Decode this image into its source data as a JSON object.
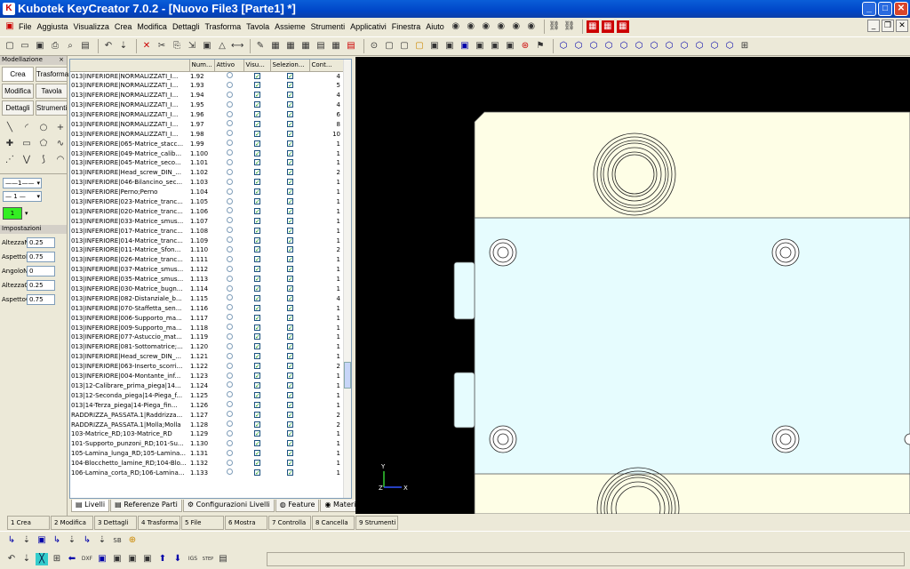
{
  "window": {
    "title": "Kubotek KeyCreator 7.0.2 - [Nuovo File3 [Parte1] *]",
    "min": "_",
    "max": "□",
    "close": "✕"
  },
  "menu": [
    "File",
    "Aggiusta",
    "Visualizza",
    "Crea",
    "Modifica",
    "Dettagli",
    "Trasforma",
    "Tavola",
    "Assieme",
    "Strumenti",
    "Applicativi",
    "Finestra",
    "Aiuto"
  ],
  "left_panel": {
    "title": "Modellazione",
    "close": "×",
    "buttons": [
      "Crea",
      "Trasforma",
      "Modifica",
      "Tavola",
      "Dettagli",
      "Strumenti"
    ],
    "line_type": "——1——",
    "line_width": "— 1 —",
    "color_value": "1",
    "color_hex": "#33ee22",
    "settings_title": "Impostazioni",
    "settings": [
      {
        "label": "AltezzaN",
        "value": "0.25"
      },
      {
        "label": "AspettoN",
        "value": "0.75"
      },
      {
        "label": "AngoloN",
        "value": "0"
      },
      {
        "label": "AltezzaQ",
        "value": "0.25"
      },
      {
        "label": "AspettoQ",
        "value": "0.75"
      }
    ]
  },
  "table": {
    "columns": [
      "",
      "Num...",
      "Attivo",
      "Visu...",
      "Selezion...",
      "Cont..."
    ],
    "rows": [
      [
        "013|INFERIORE|NORMALIZZATI_I...",
        "1.92",
        "4"
      ],
      [
        "013|INFERIORE|NORMALIZZATI_I...",
        "1.93",
        "5"
      ],
      [
        "013|INFERIORE|NORMALIZZATI_I...",
        "1.94",
        "4"
      ],
      [
        "013|INFERIORE|NORMALIZZATI_I...",
        "1.95",
        "4"
      ],
      [
        "013|INFERIORE|NORMALIZZATI_I...",
        "1.96",
        "6"
      ],
      [
        "013|INFERIORE|NORMALIZZATI_I...",
        "1.97",
        "8"
      ],
      [
        "013|INFERIORE|NORMALIZZATI_I...",
        "1.98",
        "10"
      ],
      [
        "013|INFERIORE|065-Matrice_stacc...",
        "1.99",
        "1"
      ],
      [
        "013|INFERIORE|049-Matrice_calib...",
        "1.100",
        "1"
      ],
      [
        "013|INFERIORE|045-Matrice_seco...",
        "1.101",
        "1"
      ],
      [
        "013|INFERIORE|Head_screw_DIN_...",
        "1.102",
        "2"
      ],
      [
        "013|INFERIORE|046-Bilancino_sec...",
        "1.103",
        "1"
      ],
      [
        "013|INFERIORE|Perno;Perno",
        "1.104",
        "1"
      ],
      [
        "013|INFERIORE|023-Matrice_tranc...",
        "1.105",
        "1"
      ],
      [
        "013|INFERIORE|020-Matrice_tranc...",
        "1.106",
        "1"
      ],
      [
        "013|INFERIORE|033-Matrice_smus...",
        "1.107",
        "1"
      ],
      [
        "013|INFERIORE|017-Matrice_tranc...",
        "1.108",
        "1"
      ],
      [
        "013|INFERIORE|014-Matrice_tranc...",
        "1.109",
        "1"
      ],
      [
        "013|INFERIORE|011-Matrice_Sfon...",
        "1.110",
        "2"
      ],
      [
        "013|INFERIORE|026-Matrice_tranc...",
        "1.111",
        "1"
      ],
      [
        "013|INFERIORE|037-Matrice_smus...",
        "1.112",
        "1"
      ],
      [
        "013|INFERIORE|035-Matrice_smus...",
        "1.113",
        "1"
      ],
      [
        "013|INFERIORE|030-Matrice_bugn...",
        "1.114",
        "1"
      ],
      [
        "013|INFERIORE|082-Distanziale_b...",
        "1.115",
        "4"
      ],
      [
        "013|INFERIORE|070-Staffetta_sen...",
        "1.116",
        "1"
      ],
      [
        "013|INFERIORE|006-Supporto_ma...",
        "1.117",
        "1"
      ],
      [
        "013|INFERIORE|009-Supporto_ma...",
        "1.118",
        "1"
      ],
      [
        "013|INFERIORE|077-Astuccio_mat...",
        "1.119",
        "1"
      ],
      [
        "013|INFERIORE|081-Sottomatrice;...",
        "1.120",
        "1"
      ],
      [
        "013|INFERIORE|Head_screw_DIN_...",
        "1.121",
        "1"
      ],
      [
        "013|INFERIORE|063-Inserto_scorri...",
        "1.122",
        "2"
      ],
      [
        "013|INFERIORE|004-Montante_inf...",
        "1.123",
        "1"
      ],
      [
        "013|12-Calibrare_prima_piega|14...",
        "1.124",
        "1"
      ],
      [
        "013|12-Seconda_piega|14-Piega_f...",
        "1.125",
        "1"
      ],
      [
        "013|14-Terza_piega|14-Piega_fin...",
        "1.126",
        "1"
      ],
      [
        "RADDRIZZA_PASSATA.1|Raddrizza...",
        "1.127",
        "2"
      ],
      [
        "RADDRIZZA_PASSATA.1|Molla;Molla",
        "1.128",
        "2"
      ],
      [
        "103-Matrice_RD;103-Matrice_RD",
        "1.129",
        "1"
      ],
      [
        "101-Supporto_punzoni_RD;101-Su...",
        "1.130",
        "1"
      ],
      [
        "105-Lamina_lunga_RD;105-Lamina...",
        "1.131",
        "1"
      ],
      [
        "104-Blocchetto_lamine_RD;104-Blo...",
        "1.132",
        "1"
      ],
      [
        "106-Lamina_corta_RD;106-Lamina...",
        "1.133",
        "1"
      ]
    ]
  },
  "tabs": [
    "Livelli",
    "Referenze Parti",
    "Configurazioni Livelli",
    "Feature",
    "Materiali"
  ],
  "function_keys": [
    "1 Crea",
    "2 Modifica",
    "3 Dettagli",
    "4 Trasforma",
    "5 File",
    "6 Mostra",
    "7 Controlla",
    "8 Cancella",
    "9 Strumenti"
  ],
  "viewport": {
    "background": "#000000",
    "part_color": "#fefee6",
    "cyan_color": "#e6fcfe",
    "axis_labels": {
      "x": "X",
      "y": "Y",
      "z": "Z"
    }
  },
  "toolbar_bottom1": [
    "↳",
    "⇣",
    "▣",
    "↳",
    "⇣",
    "↳",
    "⇣",
    "SB",
    "⊕"
  ],
  "toolbar_bottom2": [
    "↶",
    "⇣",
    "╳",
    "⊞",
    "⬅",
    "DXF",
    "▣",
    "▣",
    "▣",
    "▣",
    "⬆",
    "⬇",
    "IGS",
    "STEP",
    "▤"
  ],
  "toolbar_top": [
    "↶",
    "⇣",
    "✕",
    "✂",
    "⎘",
    "⇲",
    "▣",
    "△",
    "⟷",
    "✎",
    "▦",
    "▦",
    "▦",
    "▤",
    "▦",
    "▤",
    "⊙",
    "▢",
    "▢",
    "▢",
    "▣",
    "▣",
    "▣",
    "▣",
    "▣",
    "▣",
    "⊛",
    "⚑",
    "⬡",
    "⬡",
    "⬡",
    "⬡",
    "⬡",
    "⬡",
    "⬡",
    "⬡",
    "⬡",
    "⬡",
    "⬡",
    "⬡",
    "⊞"
  ]
}
